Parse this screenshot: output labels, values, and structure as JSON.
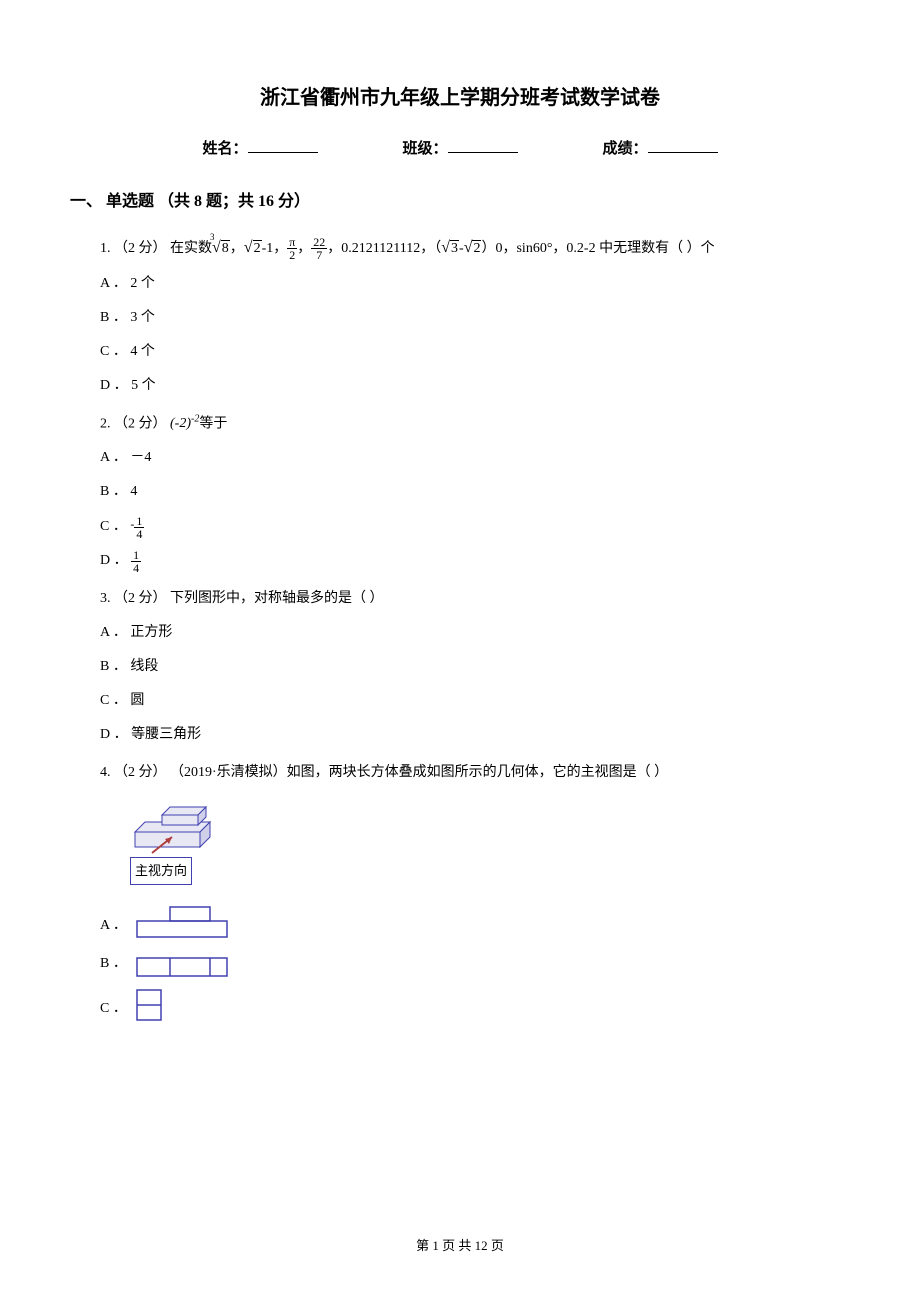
{
  "title": "浙江省衢州市九年级上学期分班考试数学试卷",
  "info": {
    "name_label": "姓名：",
    "class_label": "班级：",
    "score_label": "成绩："
  },
  "section1": {
    "header": "一、 单选题 （共 8 题；共 16 分）"
  },
  "q1": {
    "prefix": "1.  （2 分）  在实数",
    "mid1": "-1，",
    "mid2": "，",
    "mid3": "，0.2121121112，（",
    "mid4": "）0，sin60°，0.2-2 中无理数有（    ）个",
    "optA": "A ． 2 个",
    "optB": "B ． 3 个",
    "optC": "C ． 4 个",
    "optD": "D ． 5 个",
    "sqrt8": "8",
    "sqrt2": "2",
    "pi": "π",
    "two": "2",
    "n22": "22",
    "n7": "7",
    "sqrt3": "3",
    "sqrt2b": "2",
    "cube_idx": "3"
  },
  "q2": {
    "prefix": "2.  （2 分） ",
    "expr_base": "(-2)",
    "expr_exp": "-2",
    "suffix": "等于",
    "optA": "A ． －4",
    "optB": "B ． 4",
    "optC_prefix": "C ． ",
    "optC_neg": "-",
    "optD_prefix": "D ． ",
    "frac_num": "1",
    "frac_den": "4"
  },
  "q3": {
    "text": "3.  （2 分）  下列图形中，对称轴最多的是（    ）",
    "optA": "A ． 正方形",
    "optB": "B ． 线段",
    "optC": "C ． 圆",
    "optD": "D ． 等腰三角形"
  },
  "q4": {
    "text": "4.  （2 分） （2019·乐清模拟）如图，两块长方体叠成如图所示的几何体，它的主视图是（    ）",
    "main_view_label": "主视方向",
    "optA_prefix": "A ． ",
    "optB_prefix": "B ． ",
    "optC_prefix": "C ． "
  },
  "footer": {
    "text": "第 1 页 共 12 页"
  }
}
